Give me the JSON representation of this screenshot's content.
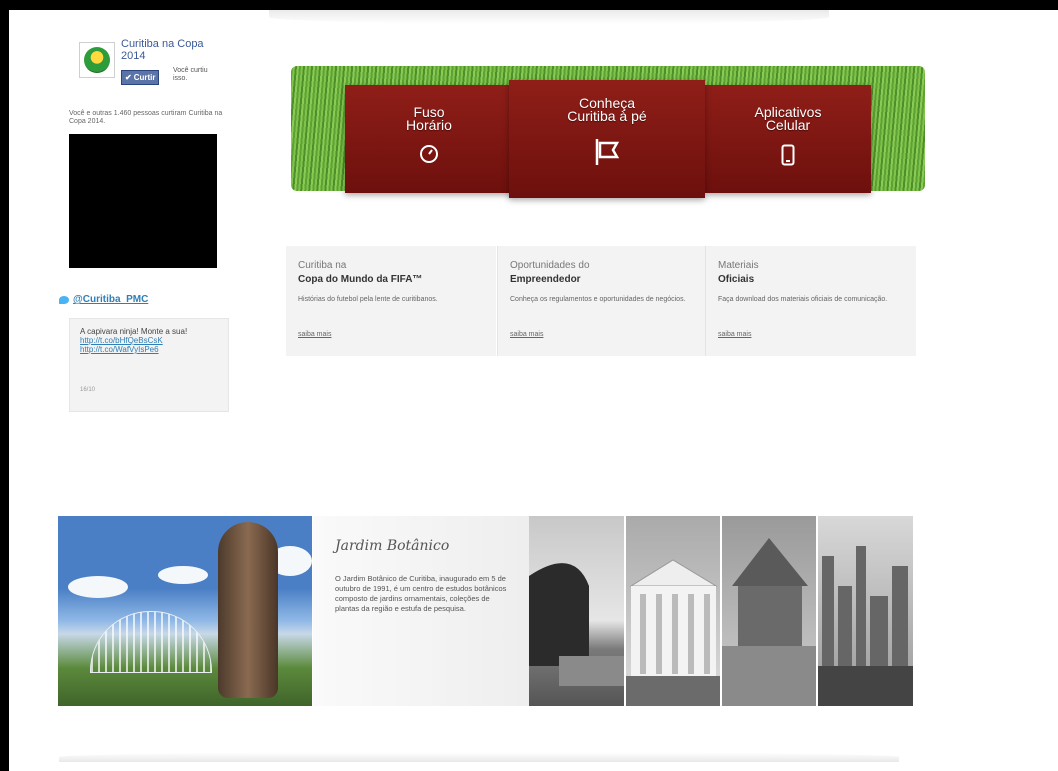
{
  "facebook": {
    "page_name": "Curitiba na Copa 2014",
    "like_label": "Curtir",
    "you_liked": "Você curtiu isso.",
    "count_text": "Você e outras 1.460 pessoas curtiram Curitiba na Copa 2014."
  },
  "twitter": {
    "handle": "@Curitiba_PMC",
    "tweet_text": "A capivara ninja! Monte a sua!",
    "link1": "http://t.co/bHfQeBsCsK",
    "link2": "http://t.co/WafVyIsPe6",
    "date": "16/10"
  },
  "hero": {
    "tiles": [
      {
        "title_l1": "Fuso",
        "title_l2": "Horário",
        "icon": "clock-icon"
      },
      {
        "title_l1": "Conheça",
        "title_l2": "Curitiba à pé",
        "icon": "flag-icon"
      },
      {
        "title_l1": "Aplicativos",
        "title_l2": "Celular",
        "icon": "phone-icon"
      }
    ]
  },
  "info_boxes": [
    {
      "line1": "Curitiba na",
      "line2": "Copa do Mundo da FIFA™",
      "desc": "Histórias do futebol pela lente de curitibanos.",
      "more": "saiba mais"
    },
    {
      "line1": "Oportunidades do",
      "line2": "Empreendedor",
      "desc": "Conheça os regulamentos e oportunidades de negócios.",
      "more": "saiba mais"
    },
    {
      "line1": "Materiais",
      "line2": "Oficiais",
      "desc": "Faça download dos materiais oficiais de comunicação.",
      "more": "saiba mais"
    }
  ],
  "garden": {
    "heading": "Jardim Botânico",
    "description": "O Jardim Botânico de Curitiba, inaugurado em 5 de outubro de 1991, é um centro de estudos botânicos composto de jardins ornamentais, coleções de plantas da região e estufa de pesquisa."
  },
  "colors": {
    "tile_red": "#8f1e18",
    "grass_green": "#6fb33e",
    "link_blue": "#2f7eb5",
    "fb_blue": "#5b74a8",
    "info_bg": "#f3f3f3"
  }
}
